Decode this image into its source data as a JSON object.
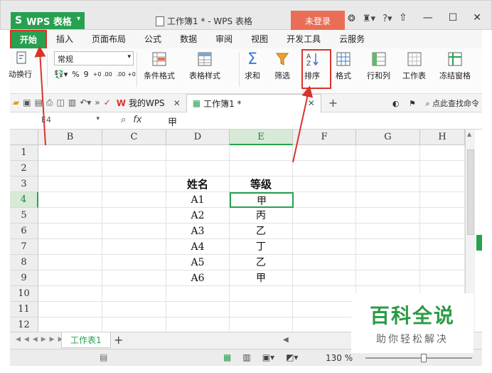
{
  "app": {
    "app_button": "WPS 表格",
    "logo_letter": "S",
    "document_title": "工作簿1 * - WPS 表格",
    "login_button": "未登录"
  },
  "ribbon": {
    "tabs": [
      {
        "label": "开始",
        "active": true
      },
      {
        "label": "插入"
      },
      {
        "label": "页面布局"
      },
      {
        "label": "公式"
      },
      {
        "label": "数据"
      },
      {
        "label": "审阅"
      },
      {
        "label": "视图"
      },
      {
        "label": "开发工具"
      },
      {
        "label": "云服务"
      }
    ]
  },
  "toolbar": {
    "wrap_label": "动换行",
    "number_format": "常规",
    "percent": "%",
    "comma": "9",
    "dec_inc": "+0 .00",
    "dec_dec": ".00 +0",
    "conditional_format": "条件格式",
    "table_style": "表格样式",
    "sum": "求和",
    "filter": "筛选",
    "sort": "排序",
    "format": "格式",
    "row_col": "行和列",
    "worksheet": "工作表",
    "freeze": "冻结窗格"
  },
  "tabs_bar": {
    "my_wps": "我的WPS",
    "doc_tab": "工作簿1 *",
    "search_placeholder": "点此查找命令"
  },
  "formula_bar": {
    "name_box": "E4",
    "fx": "fx",
    "value": "甲"
  },
  "grid": {
    "columns": [
      "B",
      "C",
      "D",
      "E",
      "F",
      "G",
      "H"
    ],
    "selected_column": "E",
    "rows": [
      "1",
      "2",
      "3",
      "4",
      "5",
      "6",
      "7",
      "8",
      "9",
      "10",
      "11",
      "12"
    ],
    "selected_row": "4",
    "cells": {
      "D3": "姓名",
      "E3": "等级",
      "D4": "A1",
      "E4": "甲",
      "D5": "A2",
      "E5": "丙",
      "D6": "A3",
      "E6": "乙",
      "D7": "A4",
      "E7": "丁",
      "D8": "A5",
      "E8": "乙",
      "D9": "A6",
      "E9": "甲"
    }
  },
  "sheet_tabs": {
    "active": "工作表1",
    "add": "+"
  },
  "status": {
    "zoom": "130 %"
  },
  "watermark": {
    "title": "百科全说",
    "subtitle": "助你轻松解决"
  },
  "colors": {
    "brand_green": "#27a150",
    "login_orange": "#e96e55",
    "highlight_red": "#d9342b"
  }
}
